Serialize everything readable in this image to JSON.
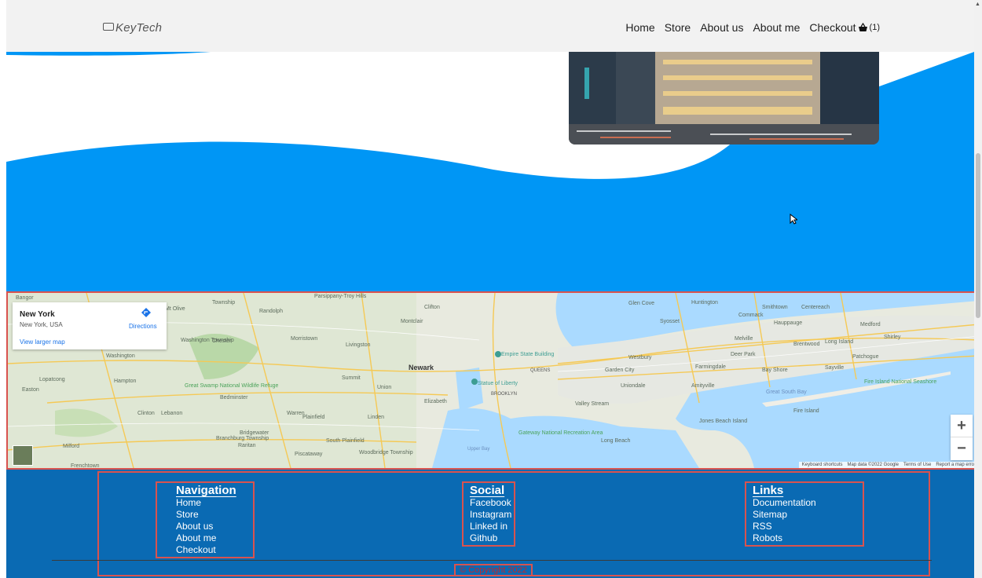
{
  "navbar": {
    "brand": "KeyTech",
    "links": [
      "Home",
      "Store",
      "About us",
      "About me",
      "Checkout"
    ],
    "cart_count": "(1)"
  },
  "map": {
    "place_title": "New York",
    "place_subtitle": "New York, USA",
    "directions_label": "Directions",
    "larger_map_label": "View larger map",
    "zoom_in": "+",
    "zoom_out": "−",
    "attribution": [
      "Keyboard shortcuts",
      "Map data ©2022 Google",
      "Terms of Use",
      "Report a map error"
    ],
    "labels": [
      "Montclair",
      "Clifton",
      "Glen Cove",
      "Huntington",
      "Smithtown",
      "Centereach",
      "Commack",
      "Hauppauge",
      "Medford",
      "Melville",
      "Brentwood",
      "Long Island",
      "Patchogue",
      "Shirley",
      "Deer Park",
      "Sayville",
      "Bay Shore",
      "Fire Island National Seashore",
      "Great South Bay",
      "Fire Island",
      "Jones Beach Island",
      "Long Beach",
      "Amityville",
      "Farmingdale",
      "Uniondale",
      "Garden City",
      "Valley Stream",
      "Westbury",
      "Syosset",
      "Newark",
      "Empire State Building",
      "QUEENS",
      "Statue of Liberty",
      "BROOKLYN",
      "Gateway National Recreation Area",
      "Elizabeth",
      "Union",
      "Linden",
      "Summit",
      "Livingston",
      "Morristown",
      "Randolph",
      "Mt Olive",
      "Washington Township",
      "Chester",
      "Washington",
      "Great Swamp National Wildlife Refuge",
      "Bedminster",
      "Hampton",
      "Lopatcong",
      "Easton",
      "Clinton",
      "Lebanon",
      "Warren",
      "Plainfield",
      "South Plainfield",
      "Bridgewater",
      "Branchburg Township",
      "Raritan",
      "Piscataway",
      "Woodbridge Township",
      "Milford",
      "Frenchtown",
      "Bangor",
      "Township",
      "Parsippany-Troy Hills",
      "Upper Bay"
    ]
  },
  "footer": {
    "columns": [
      {
        "title": "Navigation",
        "links": [
          "Home",
          "Store",
          "About us",
          "About me",
          "Checkout"
        ]
      },
      {
        "title": "Social",
        "links": [
          "Facebook",
          "Instagram",
          "Linked in",
          "Github"
        ]
      },
      {
        "title": "Links",
        "links": [
          "Documentation",
          "Sitemap",
          "RSS",
          "Robots"
        ]
      }
    ],
    "copyright": "© Copyright 2022"
  },
  "colors": {
    "hero_blue": "#0096f5",
    "footer_blue": "#0a6ab3",
    "outline_red": "#d9534f"
  }
}
